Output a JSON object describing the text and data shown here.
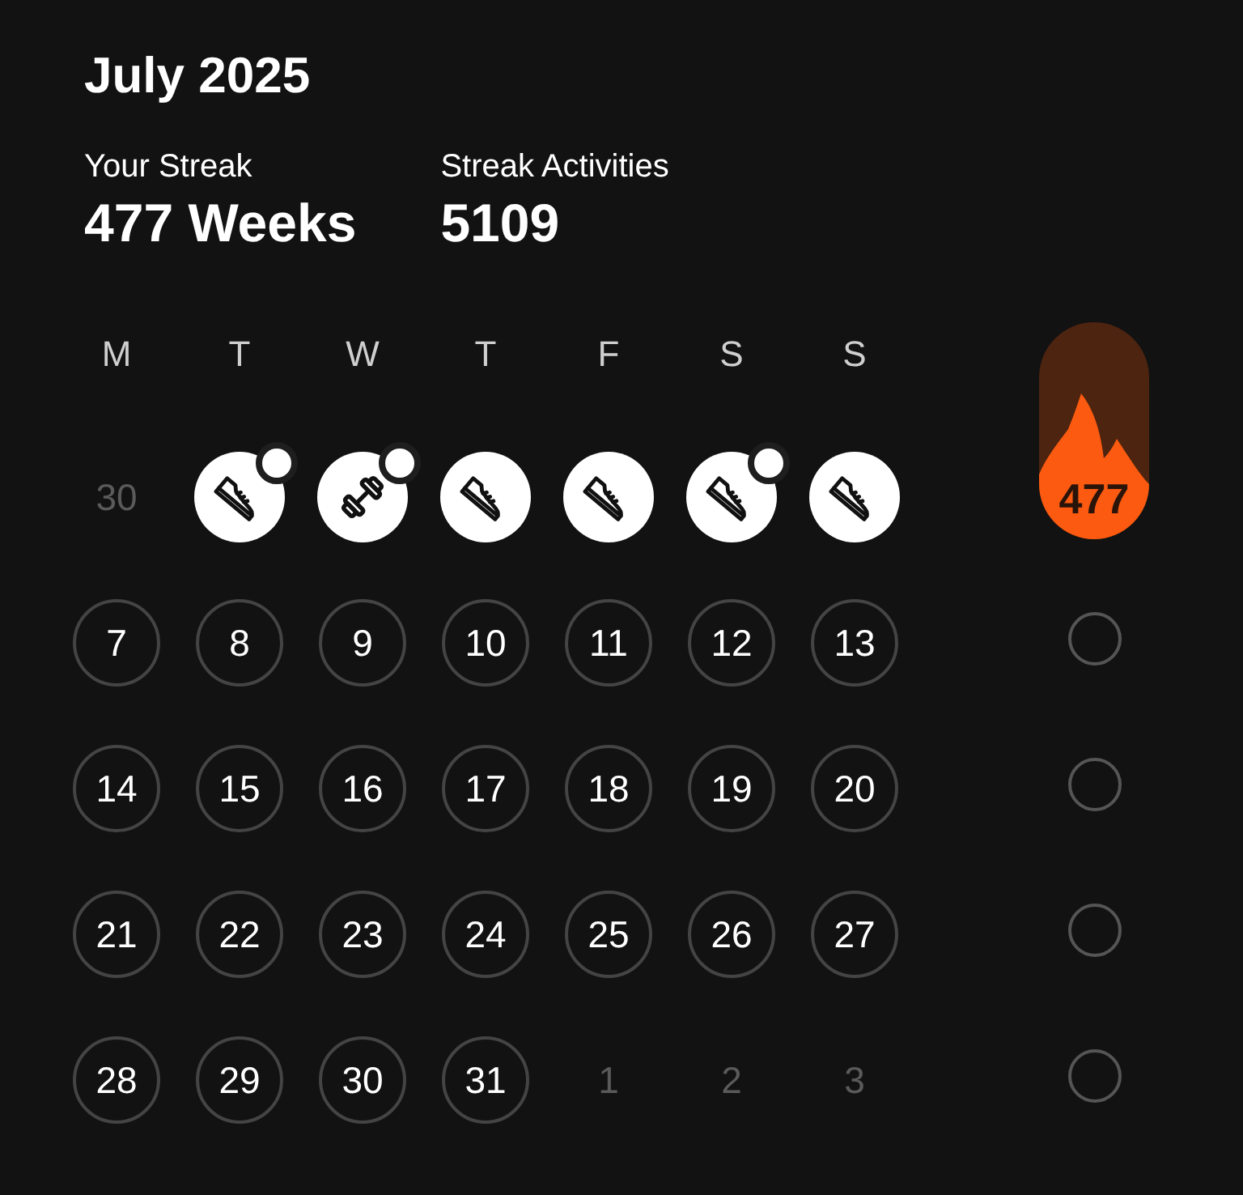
{
  "title": "July 2025",
  "stats": [
    {
      "label": "Your Streak",
      "value": "477 Weeks"
    },
    {
      "label": "Streak Activities",
      "value": "5109"
    }
  ],
  "weekdays": [
    "M",
    "T",
    "W",
    "T",
    "F",
    "S",
    "S"
  ],
  "weeks": [
    {
      "days": [
        {
          "kind": "outside",
          "label": "30"
        },
        {
          "kind": "shoe",
          "dot": true
        },
        {
          "kind": "dumbbell",
          "dot": true
        },
        {
          "kind": "shoe",
          "dot": false
        },
        {
          "kind": "shoe",
          "dot": false
        },
        {
          "kind": "shoe",
          "dot": true
        },
        {
          "kind": "shoe",
          "dot": false
        }
      ],
      "streak": {
        "kind": "flame",
        "label": "477"
      }
    },
    {
      "days": [
        {
          "kind": "day",
          "label": "7"
        },
        {
          "kind": "day",
          "label": "8"
        },
        {
          "kind": "day",
          "label": "9"
        },
        {
          "kind": "day",
          "label": "10"
        },
        {
          "kind": "day",
          "label": "11"
        },
        {
          "kind": "day",
          "label": "12"
        },
        {
          "kind": "day",
          "label": "13"
        }
      ],
      "streak": {
        "kind": "empty"
      }
    },
    {
      "days": [
        {
          "kind": "day",
          "label": "14"
        },
        {
          "kind": "day",
          "label": "15"
        },
        {
          "kind": "day",
          "label": "16"
        },
        {
          "kind": "day",
          "label": "17"
        },
        {
          "kind": "day",
          "label": "18"
        },
        {
          "kind": "day",
          "label": "19"
        },
        {
          "kind": "day",
          "label": "20"
        }
      ],
      "streak": {
        "kind": "empty"
      }
    },
    {
      "days": [
        {
          "kind": "day",
          "label": "21"
        },
        {
          "kind": "day",
          "label": "22"
        },
        {
          "kind": "day",
          "label": "23"
        },
        {
          "kind": "day",
          "label": "24"
        },
        {
          "kind": "day",
          "label": "25"
        },
        {
          "kind": "day",
          "label": "26"
        },
        {
          "kind": "day",
          "label": "27"
        }
      ],
      "streak": {
        "kind": "empty"
      }
    },
    {
      "days": [
        {
          "kind": "day",
          "label": "28"
        },
        {
          "kind": "day",
          "label": "29"
        },
        {
          "kind": "day",
          "label": "30"
        },
        {
          "kind": "day",
          "label": "31"
        },
        {
          "kind": "outside",
          "label": "1"
        },
        {
          "kind": "outside",
          "label": "2"
        },
        {
          "kind": "outside",
          "label": "3"
        }
      ],
      "streak": {
        "kind": "empty"
      }
    }
  ]
}
